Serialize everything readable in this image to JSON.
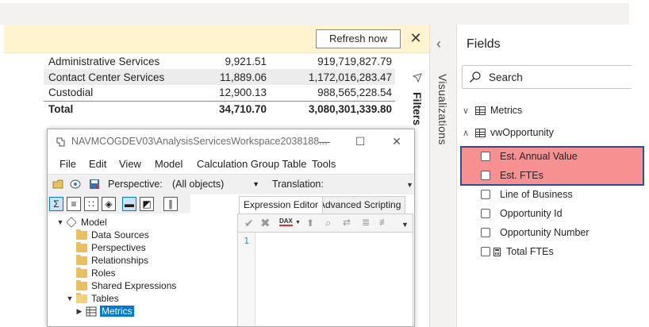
{
  "notification": {
    "refresh_label": "Refresh now",
    "close_glyph": "✕"
  },
  "report_table": {
    "rows": [
      {
        "name": "Administrative Services",
        "count": "9,921.51",
        "value": "919,719,827.79"
      },
      {
        "name": "Contact Center Services",
        "count": "11,889.06",
        "value": "1,172,016,283.47"
      },
      {
        "name": "Custodial",
        "count": "12,900.13",
        "value": "988,565,228.54"
      }
    ],
    "total": {
      "name": "Total",
      "count": "34,710.70",
      "value": "3,080,301,339.80"
    }
  },
  "side_panes": {
    "filters_label": "Filters",
    "visualizations_label": "Visualizations",
    "back_icon": "chevron-left-icon"
  },
  "fields_pane": {
    "title": "Fields",
    "search_placeholder": "Search",
    "tables": [
      {
        "name": "Metrics",
        "expanded": false
      },
      {
        "name": "vwOpportunity",
        "expanded": true
      }
    ],
    "fields": [
      {
        "name": "Est. Annual Value",
        "highlighted": true
      },
      {
        "name": "Est. FTEs",
        "highlighted": true
      },
      {
        "name": "Line of Business",
        "highlighted": false
      },
      {
        "name": "Opportunity Id",
        "highlighted": false
      },
      {
        "name": "Opportunity Number",
        "highlighted": false
      },
      {
        "name": "Total FTEs",
        "highlighted": false,
        "icon": "calculator-icon"
      }
    ],
    "highlight_color": "#f47878",
    "highlight_border": "#2e4c8f"
  },
  "tabular_editor": {
    "title": "NAVMCOGDEV03\\AnalysisServicesWorkspace2038188...",
    "menu": [
      "File",
      "Edit",
      "View",
      "Model",
      "Calculation Group Table",
      "Tools"
    ],
    "perspective_label": "Perspective:",
    "perspective_value": "(All objects)",
    "translation_label": "Translation:",
    "tree": [
      {
        "label": "Model",
        "level": 0,
        "icon": "model-icon",
        "expander": "▼"
      },
      {
        "label": "Data Sources",
        "level": 1,
        "icon": "folder-icon"
      },
      {
        "label": "Perspectives",
        "level": 1,
        "icon": "folder-icon"
      },
      {
        "label": "Relationships",
        "level": 1,
        "icon": "folder-icon"
      },
      {
        "label": "Roles",
        "level": 1,
        "icon": "folder-icon"
      },
      {
        "label": "Shared Expressions",
        "level": 1,
        "icon": "folder-icon"
      },
      {
        "label": "Tables",
        "level": 1,
        "icon": "folder-open-icon",
        "expander": "▼"
      },
      {
        "label": "Metrics",
        "level": 2,
        "icon": "table-icon",
        "expander": "▶",
        "selected": true
      }
    ],
    "tabs": [
      "Expression Editor",
      "Advanced Scripting"
    ],
    "line_number": "1",
    "dax_label": "DAX"
  }
}
